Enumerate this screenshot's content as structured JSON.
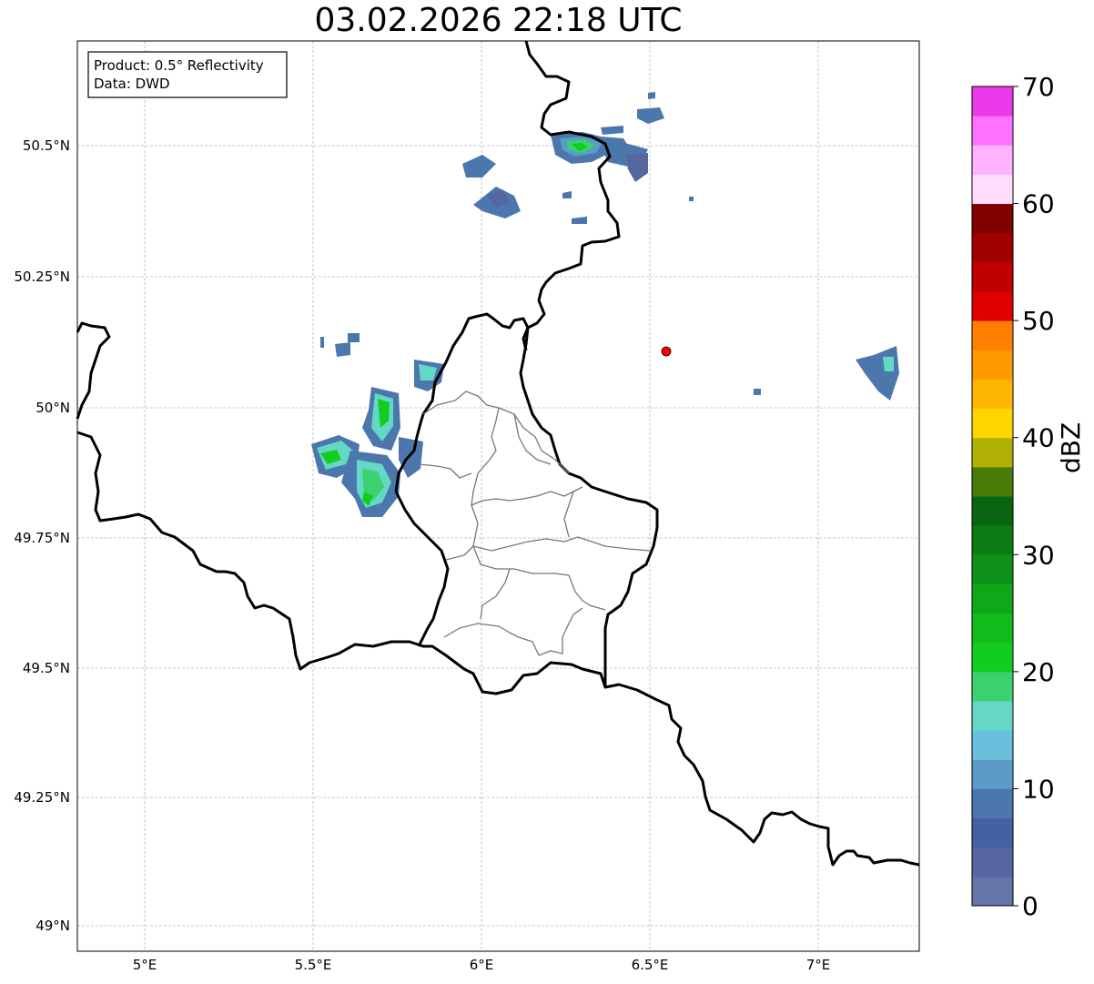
{
  "title": "03.02.2026 22:18 UTC",
  "info_box": {
    "line1": "Product: 0.5° Reflectivity",
    "line2": "Data: DWD"
  },
  "colorbar": {
    "label": "dBZ",
    "ticks": [
      "0",
      "10",
      "20",
      "30",
      "40",
      "50",
      "60",
      "70"
    ],
    "colors": [
      "#6575a8",
      "#5566a0",
      "#4461a3",
      "#4c77ad",
      "#5a9bc8",
      "#69c0dc",
      "#64d8c4",
      "#3bd16f",
      "#12cd20",
      "#10bc1b",
      "#10a818",
      "#0e911a",
      "#0b7c14",
      "#086612",
      "#4a7a08",
      "#b0b004",
      "#ffd500",
      "#ffb600",
      "#ff9900",
      "#ff7f00",
      "#e00000",
      "#c00000",
      "#a00000",
      "#800000",
      "#ffddff",
      "#ffb3ff",
      "#ff71ff",
      "#ea3aea"
    ]
  },
  "map": {
    "radar_site_color": "#ff0000",
    "x_ticks": [
      "5°E",
      "5.5°E",
      "6°E",
      "6.5°E",
      "7°E"
    ],
    "y_ticks": [
      "50.5°N",
      "50.25°N",
      "50°N",
      "49.75°N",
      "49.5°N",
      "49.25°N",
      "49°N"
    ]
  }
}
